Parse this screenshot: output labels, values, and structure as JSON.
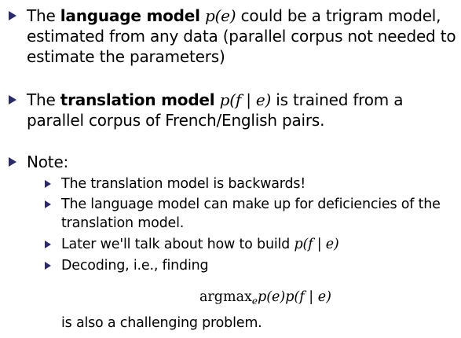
{
  "bullets": [
    {
      "pre": "The ",
      "bold": "language model",
      "math": "p(e)",
      "post": " could be a trigram model, estimated from any data (parallel corpus not needed to estimate the parameters)"
    },
    {
      "pre": "The ",
      "bold": "translation model",
      "math": "p(f | e)",
      "post": " is trained from a parallel corpus of French/English pairs."
    },
    {
      "label": "Note:"
    }
  ],
  "note_items": [
    {
      "text": "The translation model is backwards!"
    },
    {
      "text": "The language model can make up for deficiencies of the translation model."
    },
    {
      "pre": "Later we'll talk about how to build ",
      "math": "p(f | e)"
    },
    {
      "text": "Decoding, i.e., finding"
    }
  ],
  "equation": {
    "operator": "argmax",
    "subscript": "e",
    "body": "p(e)p(f | e)"
  },
  "continuation": "is also a challenging problem.",
  "colors": {
    "marker": "#2a2a6e",
    "text": "#000000"
  }
}
